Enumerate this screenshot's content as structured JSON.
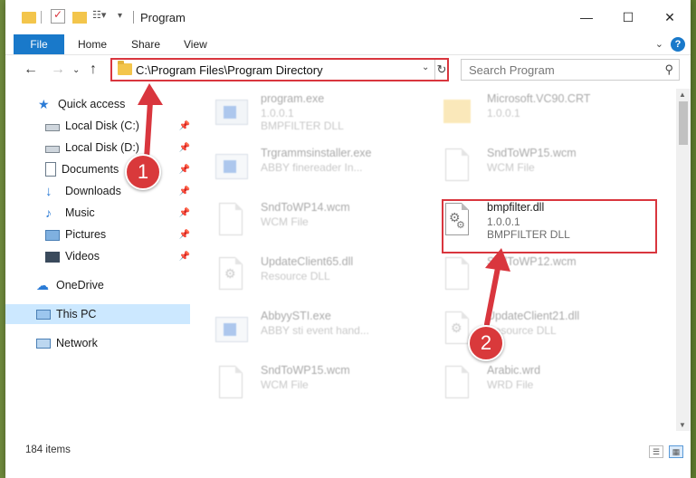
{
  "window": {
    "title": "Program",
    "controls": {
      "minimize": "—",
      "maximize": "☐",
      "close": "✕"
    }
  },
  "ribbon": {
    "file_tab": "File",
    "tabs": [
      "Home",
      "Share",
      "View"
    ],
    "help": "?"
  },
  "address": {
    "path": "C:\\Program Files\\Program Directory",
    "search_placeholder": "Search Program"
  },
  "nav": {
    "quick_access": "Quick access",
    "items": [
      {
        "label": "Local Disk (C:)",
        "pinned": true
      },
      {
        "label": "Local Disk (D:)",
        "pinned": true
      },
      {
        "label": "Documents",
        "pinned": true
      },
      {
        "label": "Downloads",
        "pinned": true
      },
      {
        "label": "Music",
        "pinned": true
      },
      {
        "label": "Pictures",
        "pinned": true
      },
      {
        "label": "Videos",
        "pinned": true
      }
    ],
    "onedrive": "OneDrive",
    "this_pc": "This PC",
    "network": "Network"
  },
  "files": [
    {
      "name": "program.exe",
      "line2": "1.0.0.1",
      "line3": "BMPFILTER DLL"
    },
    {
      "name": "Microsoft.VC90.CRT",
      "line2": "1.0.0.1",
      "line3": ""
    },
    {
      "name": "Trgrammsinstaller.exe",
      "line2": "ABBY finereader In...",
      "line3": ""
    },
    {
      "name": "SndToWP15.wcm",
      "line2": "WCM File",
      "line3": ""
    },
    {
      "name": "SndToWP14.wcm",
      "line2": "WCM File",
      "line3": ""
    },
    {
      "name": "bmpfilter.dll",
      "line2": "1.0.0.1",
      "line3": "BMPFILTER DLL"
    },
    {
      "name": "UpdateClient65.dll",
      "line2": "Resource DLL",
      "line3": ""
    },
    {
      "name": "SndToWP12.wcm",
      "line2": "",
      "line3": ""
    },
    {
      "name": "AbbyySTI.exe",
      "line2": "ABBY sti event hand...",
      "line3": ""
    },
    {
      "name": "UpdateClient21.dll",
      "line2": "Resource DLL",
      "line3": ""
    },
    {
      "name": "SndToWP15.wcm",
      "line2": "WCM File",
      "line3": ""
    },
    {
      "name": "Arabic.wrd",
      "line2": "WRD File",
      "line3": ""
    }
  ],
  "status": {
    "item_count": "184 items"
  },
  "callouts": [
    "1",
    "2"
  ],
  "colors": {
    "highlight": "#d9363e",
    "accent": "#1979ca",
    "selection": "#cce8ff"
  }
}
